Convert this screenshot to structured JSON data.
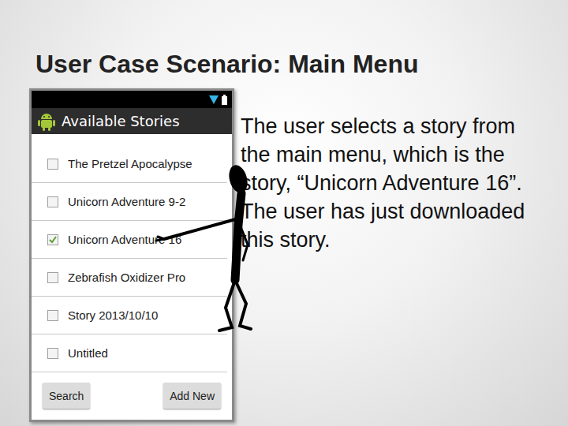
{
  "slide": {
    "title": "User Case Scenario: Main Menu",
    "description": "The user selects a story from the main menu, which is the story, “Unicorn Adventure 16”. The user has just downloaded this story."
  },
  "phone": {
    "title": "Available Stories",
    "stories": [
      {
        "label": "The Pretzel Apocalypse",
        "checked": false
      },
      {
        "label": "Unicorn Adventure 9-2",
        "checked": false
      },
      {
        "label": "Unicorn Adventure 16",
        "checked": true
      },
      {
        "label": "Zebrafish Oxidizer Pro",
        "checked": false
      },
      {
        "label": "Story 2013/10/10",
        "checked": false
      },
      {
        "label": "Untitled",
        "checked": false
      }
    ],
    "buttons": [
      "Search",
      "Add New"
    ]
  }
}
